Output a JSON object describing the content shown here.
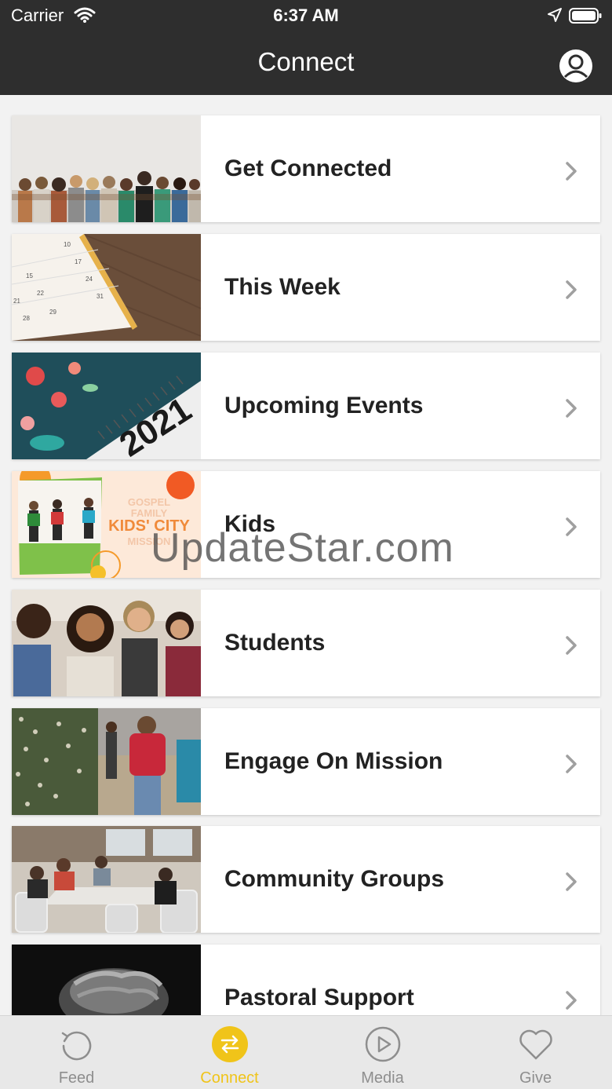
{
  "status_bar": {
    "carrier": "Carrier",
    "time": "6:37 AM"
  },
  "nav": {
    "title": "Connect"
  },
  "items": [
    {
      "label": "Get Connected"
    },
    {
      "label": "This Week"
    },
    {
      "label": "Upcoming Events"
    },
    {
      "label": "Kids"
    },
    {
      "label": "Students"
    },
    {
      "label": "Engage On Mission"
    },
    {
      "label": "Community Groups"
    },
    {
      "label": "Pastoral Support"
    }
  ],
  "thumb_text": {
    "calendar_numbers": [
      "10",
      "17",
      "15",
      "24",
      "22",
      "31",
      "21",
      "29",
      "28"
    ],
    "year": "2021",
    "kids_lines": [
      "GOSPEL",
      "FAMILY",
      "KIDS' CITY",
      "MISSION"
    ]
  },
  "watermark": "UpdateStar.com",
  "tabs": [
    {
      "label": "Feed",
      "icon": "refresh-icon",
      "active": false
    },
    {
      "label": "Connect",
      "icon": "swap-arrows-icon",
      "active": true
    },
    {
      "label": "Media",
      "icon": "play-icon",
      "active": false
    },
    {
      "label": "Give",
      "icon": "heart-icon",
      "active": false
    }
  ],
  "colors": {
    "bar": "#2e2e2e",
    "accent": "#f0c419",
    "inactive": "#8e8e8e"
  }
}
